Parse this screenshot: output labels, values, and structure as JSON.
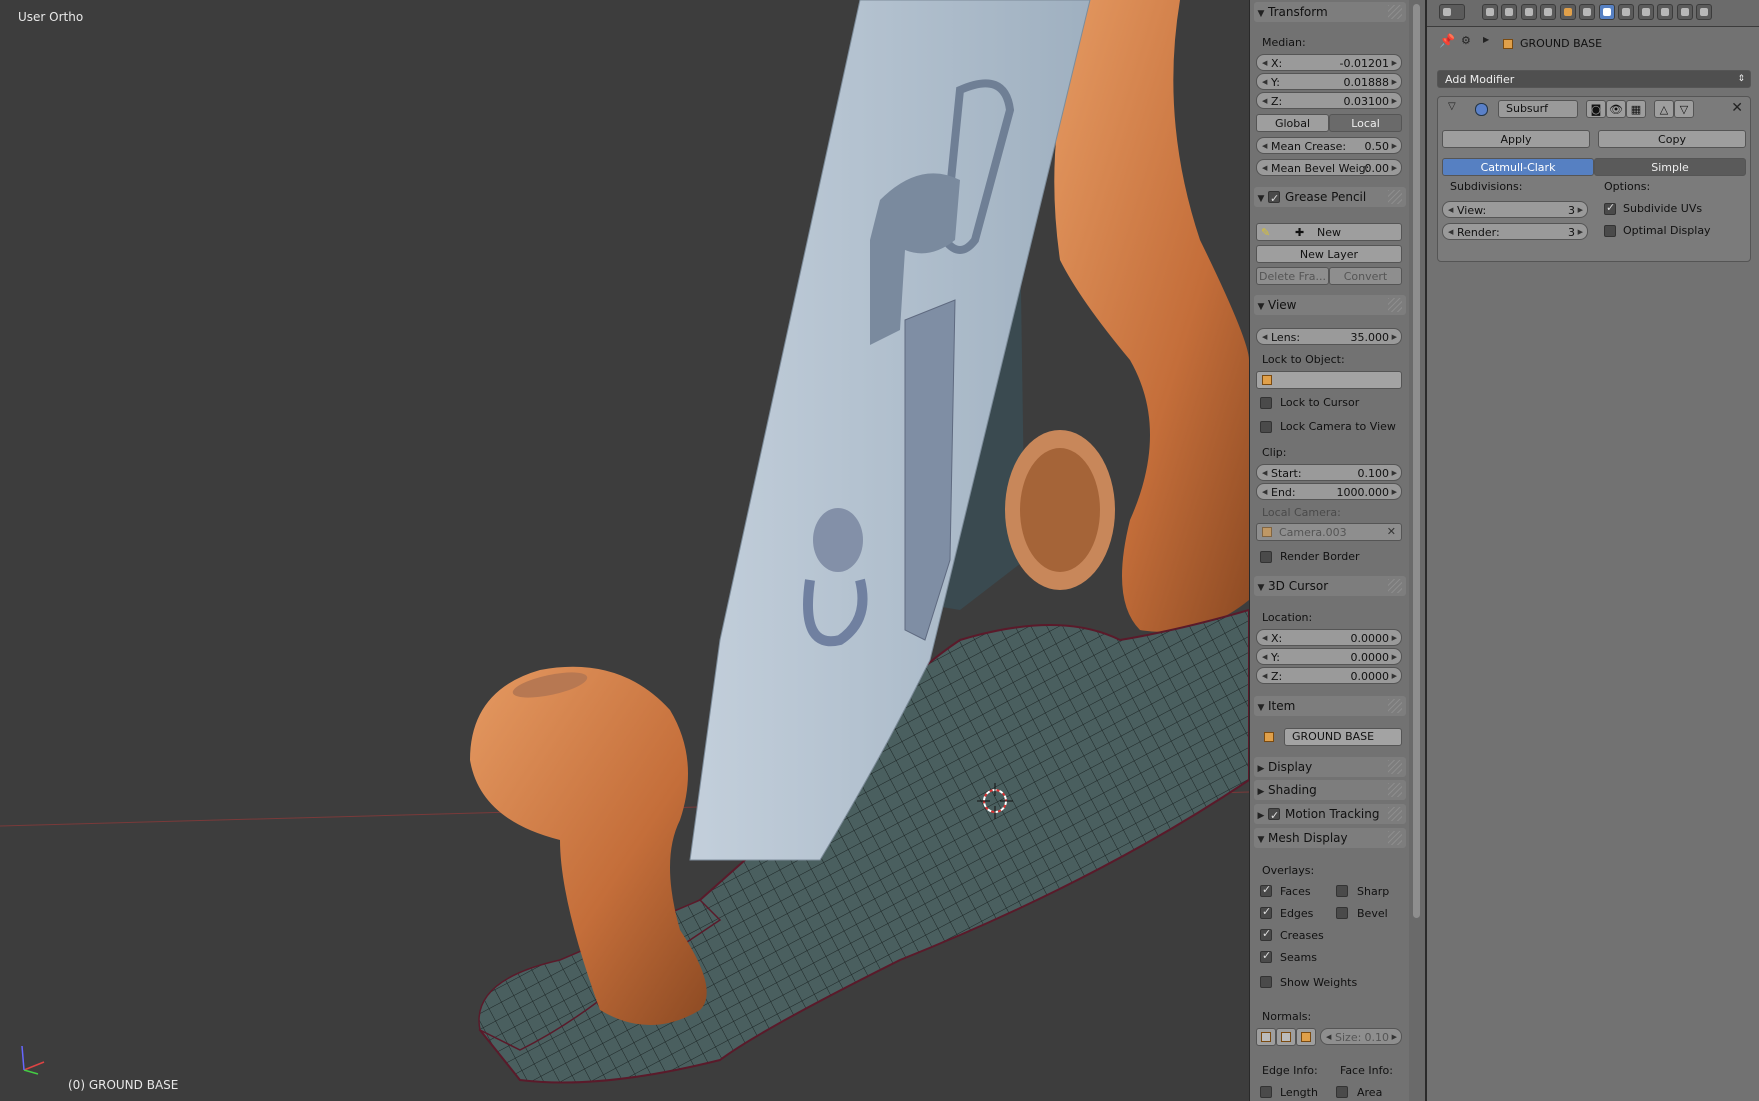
{
  "viewport": {
    "title": "User Ortho",
    "object_label": "(0) GROUND BASE"
  },
  "npanel": {
    "transform": {
      "header": "Transform",
      "median_label": "Median:",
      "x": {
        "label": "X:",
        "value": "-0.01201"
      },
      "y": {
        "label": "Y:",
        "value": "0.01888"
      },
      "z": {
        "label": "Z:",
        "value": "0.03100"
      },
      "global": "Global",
      "local": "Local",
      "mean_crease": {
        "label": "Mean Crease:",
        "value": "0.50"
      },
      "mean_bevel": {
        "label": "Mean Bevel Weig:",
        "value": "0.00"
      }
    },
    "grease_pencil": {
      "header": "Grease Pencil",
      "new": "New",
      "new_layer": "New Layer",
      "delete_frame": "Delete Fra...",
      "convert": "Convert"
    },
    "view": {
      "header": "View",
      "lens": {
        "label": "Lens:",
        "value": "35.000"
      },
      "lock_to_object": "Lock to Object:",
      "lock_to_cursor": "Lock to Cursor",
      "lock_camera": "Lock Camera to View",
      "clip": "Clip:",
      "start": {
        "label": "Start:",
        "value": "0.100"
      },
      "end": {
        "label": "End:",
        "value": "1000.000"
      },
      "local_camera": "Local Camera:",
      "camera_name": "Camera.003",
      "render_border": "Render Border"
    },
    "cursor": {
      "header": "3D Cursor",
      "location": "Location:",
      "x": {
        "label": "X:",
        "value": "0.0000"
      },
      "y": {
        "label": "Y:",
        "value": "0.0000"
      },
      "z": {
        "label": "Z:",
        "value": "0.0000"
      }
    },
    "item": {
      "header": "Item",
      "name": "GROUND BASE"
    },
    "display": "Display",
    "shading": "Shading",
    "motion_tracking": "Motion Tracking",
    "mesh_display": {
      "header": "Mesh Display",
      "overlays": "Overlays:",
      "faces": "Faces",
      "sharp": "Sharp",
      "edges": "Edges",
      "bevel": "Bevel",
      "creases": "Creases",
      "seams": "Seams",
      "show_weights": "Show Weights",
      "normals": "Normals:",
      "size": {
        "label": "Size:",
        "value": "0.10"
      },
      "edge_info": "Edge Info:",
      "face_info": "Face Info:",
      "length": "Length",
      "area": "Area"
    }
  },
  "properties": {
    "breadcrumb_object": "GROUND BASE",
    "add_modifier": "Add Modifier",
    "modifier": {
      "name": "Subsurf",
      "apply": "Apply",
      "copy": "Copy",
      "catmull_clark": "Catmull-Clark",
      "simple": "Simple",
      "subdivisions": "Subdivisions:",
      "options": "Options:",
      "view": {
        "label": "View:",
        "value": "3"
      },
      "render": {
        "label": "Render:",
        "value": "3"
      },
      "subdivide_uvs": "Subdivide UVs",
      "optimal_display": "Optimal Display"
    }
  },
  "colors": {
    "accent": "#5680c2",
    "panel": "#727272",
    "viewport": "#3d3d3d",
    "wood": "#c8733f",
    "mesh": "#3b4f4f"
  }
}
